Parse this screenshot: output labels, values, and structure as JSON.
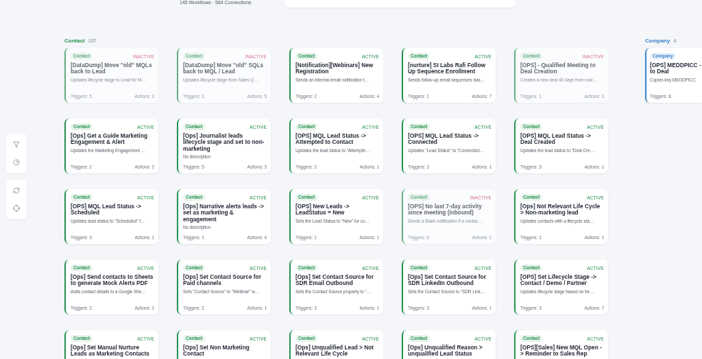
{
  "summary": "145 Workflows · 584 Connections",
  "columns": [
    {
      "title": "Contact",
      "count": "107",
      "color": "#23924f",
      "cards": [
        {
          "badge": "Contact",
          "status": "INACTIVE",
          "active": false,
          "title": "[DataDump] Move \"old\" MQLs back to Lead",
          "description": "Updates lifecycle stage to Lead for M…",
          "triggers": "Triggers: 5",
          "actions": "Actions: 2"
        },
        {
          "badge": "Contact",
          "status": "INACTIVE",
          "active": false,
          "title": "[DataDump] Move \"old\" SQLs back to MQL / Lead",
          "description": "Updates lifecycle stage from Sales Q…",
          "triggers": "Triggers: 3",
          "actions": "Actions: 5"
        },
        {
          "badge": "Contact",
          "status": "ACTIVE",
          "active": true,
          "title": "[Notification][Webinars] New Registration",
          "description": "Sends an internal email notification t…",
          "triggers": "Triggers: 2",
          "actions": "Actions: 4"
        },
        {
          "badge": "Contact",
          "status": "ACTIVE",
          "active": true,
          "title": "[nurture] SI Labs Rafi Follow Up Sequence Enrollment",
          "description": "Sends follow-up email sequences bas…",
          "triggers": "Triggers: 1",
          "actions": "Actions: 7"
        },
        {
          "badge": "Contact",
          "status": "INACTIVE",
          "active": false,
          "title": "[OPS] - Qualified Meeting to Deal Creation",
          "description": "Creates a new deal 40 days from now…",
          "triggers": "Triggers: 1",
          "actions": "Actions: 3"
        },
        {
          "badge": "Contact",
          "status": "ACTIVE",
          "active": true,
          "title": "[Ops] Get a Guide Marketing Engagement & Alert",
          "description": "Updates the Marketing Engagement …",
          "triggers": "Triggers: 2",
          "actions": "Actions: 2"
        },
        {
          "badge": "Contact",
          "status": "ACTIVE",
          "active": true,
          "title": "[Ops] Journalist leads lifecycle stage and set to non-marketing",
          "description": "No description",
          "triggers": "Triggers: 5",
          "actions": "Actions: 3"
        },
        {
          "badge": "Contact",
          "status": "ACTIVE",
          "active": true,
          "title": "[OPS] MQL Lead Status -> Attempted to Contact",
          "description": "Updates the lead status to \"Attempte…",
          "triggers": "Triggers: 3",
          "actions": "Actions: 1"
        },
        {
          "badge": "Contact",
          "status": "ACTIVE",
          "active": true,
          "title": "[OPS] MQL Lead Status -> Connected",
          "description": "Updates \"Lead Status\" to \"Connected…",
          "triggers": "Triggers: 3",
          "actions": "Actions: 1"
        },
        {
          "badge": "Contact",
          "status": "ACTIVE",
          "active": true,
          "title": "[OPS] MQL Lead Status -> Deal Created",
          "description": "Updates the lead status to \"Deal Cre…",
          "triggers": "Triggers: 3",
          "actions": "Actions: 1"
        },
        {
          "badge": "Contact",
          "status": "ACTIVE",
          "active": true,
          "title": "[OPS] MQL Lead Status -> Scheduled",
          "description": "Updates lead status to \"Scheduled\" f…",
          "triggers": "Triggers: 3",
          "actions": "Actions: 1"
        },
        {
          "badge": "Contact",
          "status": "ACTIVE",
          "active": true,
          "title": "[Ops] Narrative alerts leads -> set as marketing & engagement",
          "description": "No description",
          "triggers": "Triggers: 1",
          "actions": "Actions: 4"
        },
        {
          "badge": "Contact",
          "status": "ACTIVE",
          "active": true,
          "title": "[OPS] New Leads -> LeadStatus = New",
          "description": "Sets the Lead Status to \"New\" for co…",
          "triggers": "Triggers: 1",
          "actions": "Actions: 1"
        },
        {
          "badge": "Contact",
          "status": "INACTIVE",
          "active": false,
          "title": "[OPS] No last 7-day activity since meeting (inbound)",
          "description": "Sends a Slack notification if a contac…",
          "triggers": "Triggers: 9",
          "actions": "Actions: 1"
        },
        {
          "badge": "Contact",
          "status": "ACTIVE",
          "active": true,
          "title": "[Ops] Not Relevant Life Cycle > Non-marketing lead",
          "description": "Updates contacts with a lifecycle sta…",
          "triggers": "Triggers: 1",
          "actions": "Actions: 1"
        },
        {
          "badge": "Contact",
          "status": "ACTIVE",
          "active": true,
          "title": "[Ops] Send contacts to Sheets to generate Mock Alerts PDF",
          "description": "Adds contact details to a Google She…",
          "triggers": "Triggers: 2",
          "actions": "Actions: 1"
        },
        {
          "badge": "Contact",
          "status": "ACTIVE",
          "active": true,
          "title": "[Ops] Set Contact Source for Paid channels",
          "description": "Sets \"Contact Source\" to \"Webinar\" w…",
          "triggers": "Triggers: 2",
          "actions": "Actions: 1"
        },
        {
          "badge": "Contact",
          "status": "ACTIVE",
          "active": true,
          "title": "[Ops] Set Contact Source for SDR Email Outbound",
          "description": "Sets the Contact Source property to \"…",
          "triggers": "Triggers: 3",
          "actions": "Actions: 1"
        },
        {
          "badge": "Contact",
          "status": "ACTIVE",
          "active": true,
          "title": "[Ops] Set Contact Source for SDR LinkedIn Outbound",
          "description": "Sets the Contact Source to \"SDR Link…",
          "triggers": "Triggers: 3",
          "actions": "Actions: 1"
        },
        {
          "badge": "Contact",
          "status": "ACTIVE",
          "active": true,
          "title": "[OPS] Set Lifecycle Stage -> Contact / Demo / Partner",
          "description": "Updates lifecycle stage based on for…",
          "triggers": "Triggers: 3",
          "actions": "Actions: 7"
        },
        {
          "badge": "Contact",
          "status": "ACTIVE",
          "active": true,
          "title": "[Ops] Set Manual Nurture Leads as Marketing Contacts"
        },
        {
          "badge": "Contact",
          "status": "ACTIVE",
          "active": true,
          "title": "[Ops] Set Non Marketing Contact"
        },
        {
          "badge": "Contact",
          "status": "ACTIVE",
          "active": true,
          "title": "[Ops] Unqualified Lead > Not Relevant Life Cycle"
        },
        {
          "badge": "Contact",
          "status": "ACTIVE",
          "active": true,
          "title": "[Ops] Unqualified Reason > unqualified Lead Status"
        },
        {
          "badge": "Contact",
          "status": "ACTIVE",
          "active": true,
          "title": "[OPS][Sales] New MQL Open -> Reminder to Sales Rep"
        }
      ]
    },
    {
      "title": "Company",
      "count": "4",
      "color": "#3b84c9",
      "cards": [
        {
          "badge": "Company",
          "active": true,
          "title": "[OPS] MEDDPICC - to Deal",
          "description": "Copies key MEDDPICC",
          "triggers": "Triggers: 8"
        }
      ]
    }
  ]
}
